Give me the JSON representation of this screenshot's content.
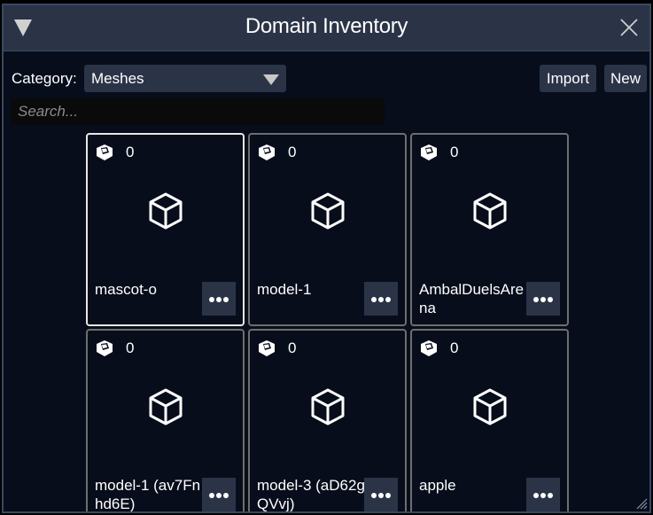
{
  "window": {
    "title": "Domain Inventory",
    "collapse_icon": "triangle-down-icon",
    "close_icon": "close-icon"
  },
  "toolbar": {
    "category_label": "Category:",
    "category_value": "Meshes",
    "import_label": "Import",
    "new_label": "New",
    "search_placeholder": "Search...",
    "search_value": ""
  },
  "items": [
    {
      "name": "mascot-o",
      "count": "0",
      "selected": true
    },
    {
      "name": "model-1",
      "count": "0",
      "selected": false
    },
    {
      "name": "AmbalDuelsArena",
      "count": "0",
      "selected": false
    },
    {
      "name": "model-1 (av7Fnhd6E)",
      "count": "0",
      "selected": false
    },
    {
      "name": "model-3 (aD62gQVvj)",
      "count": "0",
      "selected": false
    },
    {
      "name": "apple",
      "count": "0",
      "selected": false
    }
  ],
  "colors": {
    "background": "#070d1b",
    "panel": "#2b3447",
    "card_border": "#6e6e6e",
    "card_border_selected": "#e6e6e6"
  }
}
